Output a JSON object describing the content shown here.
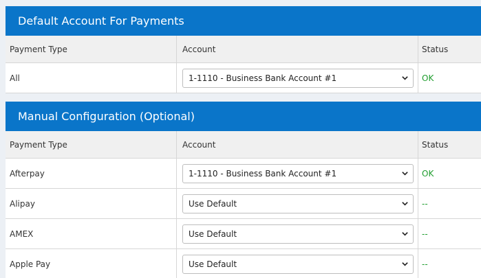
{
  "default_panel": {
    "title": "Default Account For Payments",
    "headers": {
      "type": "Payment Type",
      "account": "Account",
      "status": "Status"
    },
    "rows": [
      {
        "type": "All",
        "account": "1-1110 - Business Bank Account #1",
        "status": "OK"
      }
    ]
  },
  "manual_panel": {
    "title": "Manual Configuration (Optional)",
    "headers": {
      "type": "Payment Type",
      "account": "Account",
      "status": "Status"
    },
    "rows": [
      {
        "type": "Afterpay",
        "account": "1-1110 - Business Bank Account #1",
        "status": "OK"
      },
      {
        "type": "Alipay",
        "account": "Use Default",
        "status": "--"
      },
      {
        "type": "AMEX",
        "account": "Use Default",
        "status": "--"
      },
      {
        "type": "Apple Pay",
        "account": "Use Default",
        "status": "--"
      }
    ]
  },
  "colors": {
    "header_bg": "#0a75c9",
    "status_ok": "#1f9d2e"
  },
  "icons": {
    "select_arrow": "chevron-down-icon"
  }
}
